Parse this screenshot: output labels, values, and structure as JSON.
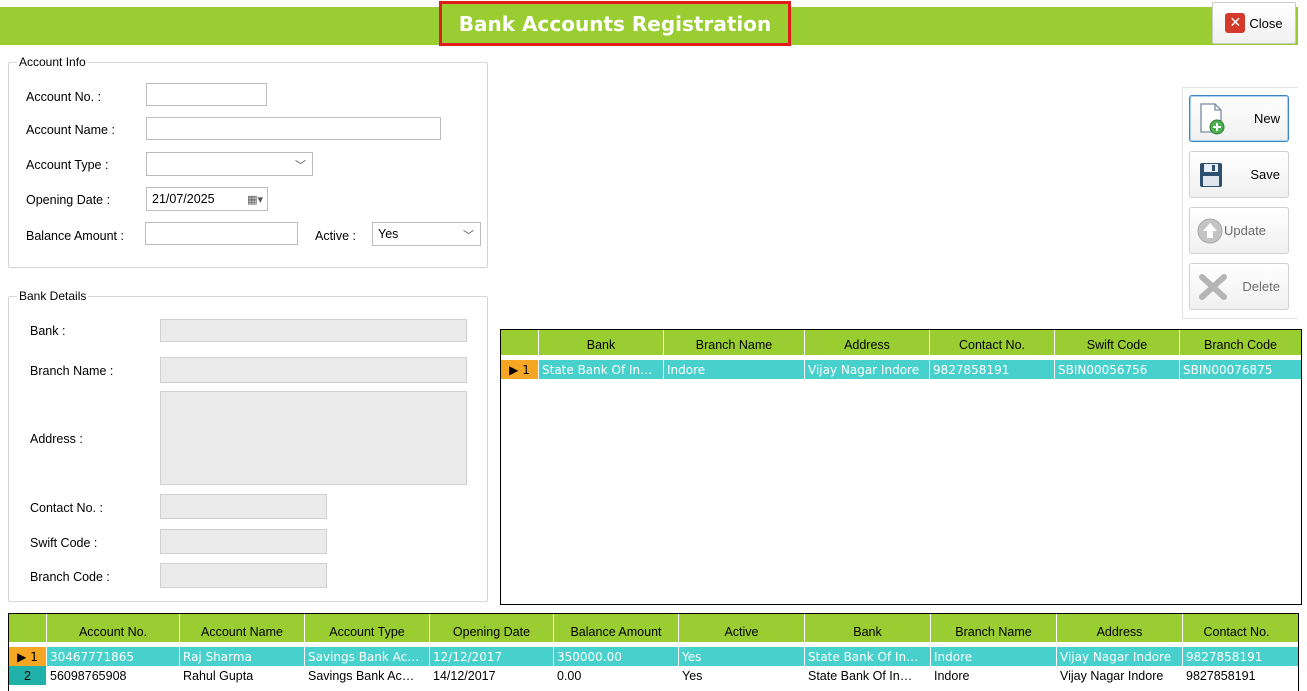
{
  "header": {
    "title": "Bank Accounts Registration",
    "close_label": "Close"
  },
  "account_info": {
    "legend": "Account Info",
    "account_no_label": "Account No. :",
    "account_no_value": "",
    "account_name_label": "Account Name :",
    "account_name_value": "",
    "account_type_label": "Account Type :",
    "account_type_value": "",
    "opening_date_label": "Opening Date :",
    "opening_date_value": "21/07/2025",
    "balance_label": "Balance Amount :",
    "balance_value": "",
    "active_label": "Active :",
    "active_value": "Yes"
  },
  "bank_details": {
    "legend": "Bank Details",
    "bank_label": "Bank :",
    "branch_label": "Branch Name :",
    "address_label": "Address :",
    "contact_label": "Contact No. :",
    "swift_label": "Swift Code :",
    "branch_code_label": "Branch Code :"
  },
  "actions": {
    "new": "New",
    "save": "Save",
    "update": "Update",
    "delete": "Delete"
  },
  "bank_grid": {
    "columns": [
      "Bank",
      "Branch Name",
      "Address",
      "Contact No.",
      "Swift Code",
      "Branch Code"
    ],
    "rows": [
      {
        "num": "1",
        "cells": [
          "State Bank Of In…",
          "Indore",
          "Vijay Nagar Indore",
          "9827858191",
          "SBIN00056756",
          "SBIN00076875"
        ]
      }
    ]
  },
  "accounts_grid": {
    "columns": [
      "Account No.",
      "Account Name",
      "Account Type",
      "Opening Date",
      "Balance Amount",
      "Active",
      "Bank",
      "Branch Name",
      "Address",
      "Contact No."
    ],
    "rows": [
      {
        "num": "1",
        "cells": [
          "30467771865",
          "Raj Sharma",
          "Savings Bank Ac…",
          "12/12/2017",
          "350000.00",
          "Yes",
          "State Bank Of In…",
          "Indore",
          "Vijay Nagar Indore",
          "9827858191"
        ]
      },
      {
        "num": "2",
        "cells": [
          "56098765908",
          "Rahul Gupta",
          "Savings Bank Ac…",
          "14/12/2017",
          "0.00",
          "Yes",
          "State Bank Of In…",
          "Indore",
          "Vijay Nagar Indore",
          "9827858191"
        ]
      }
    ]
  },
  "colors": {
    "header_green": "#9acd32",
    "selected_row": "#48d1cc",
    "current_row_marker": "#f5a623",
    "title_border": "#e01b1b"
  }
}
